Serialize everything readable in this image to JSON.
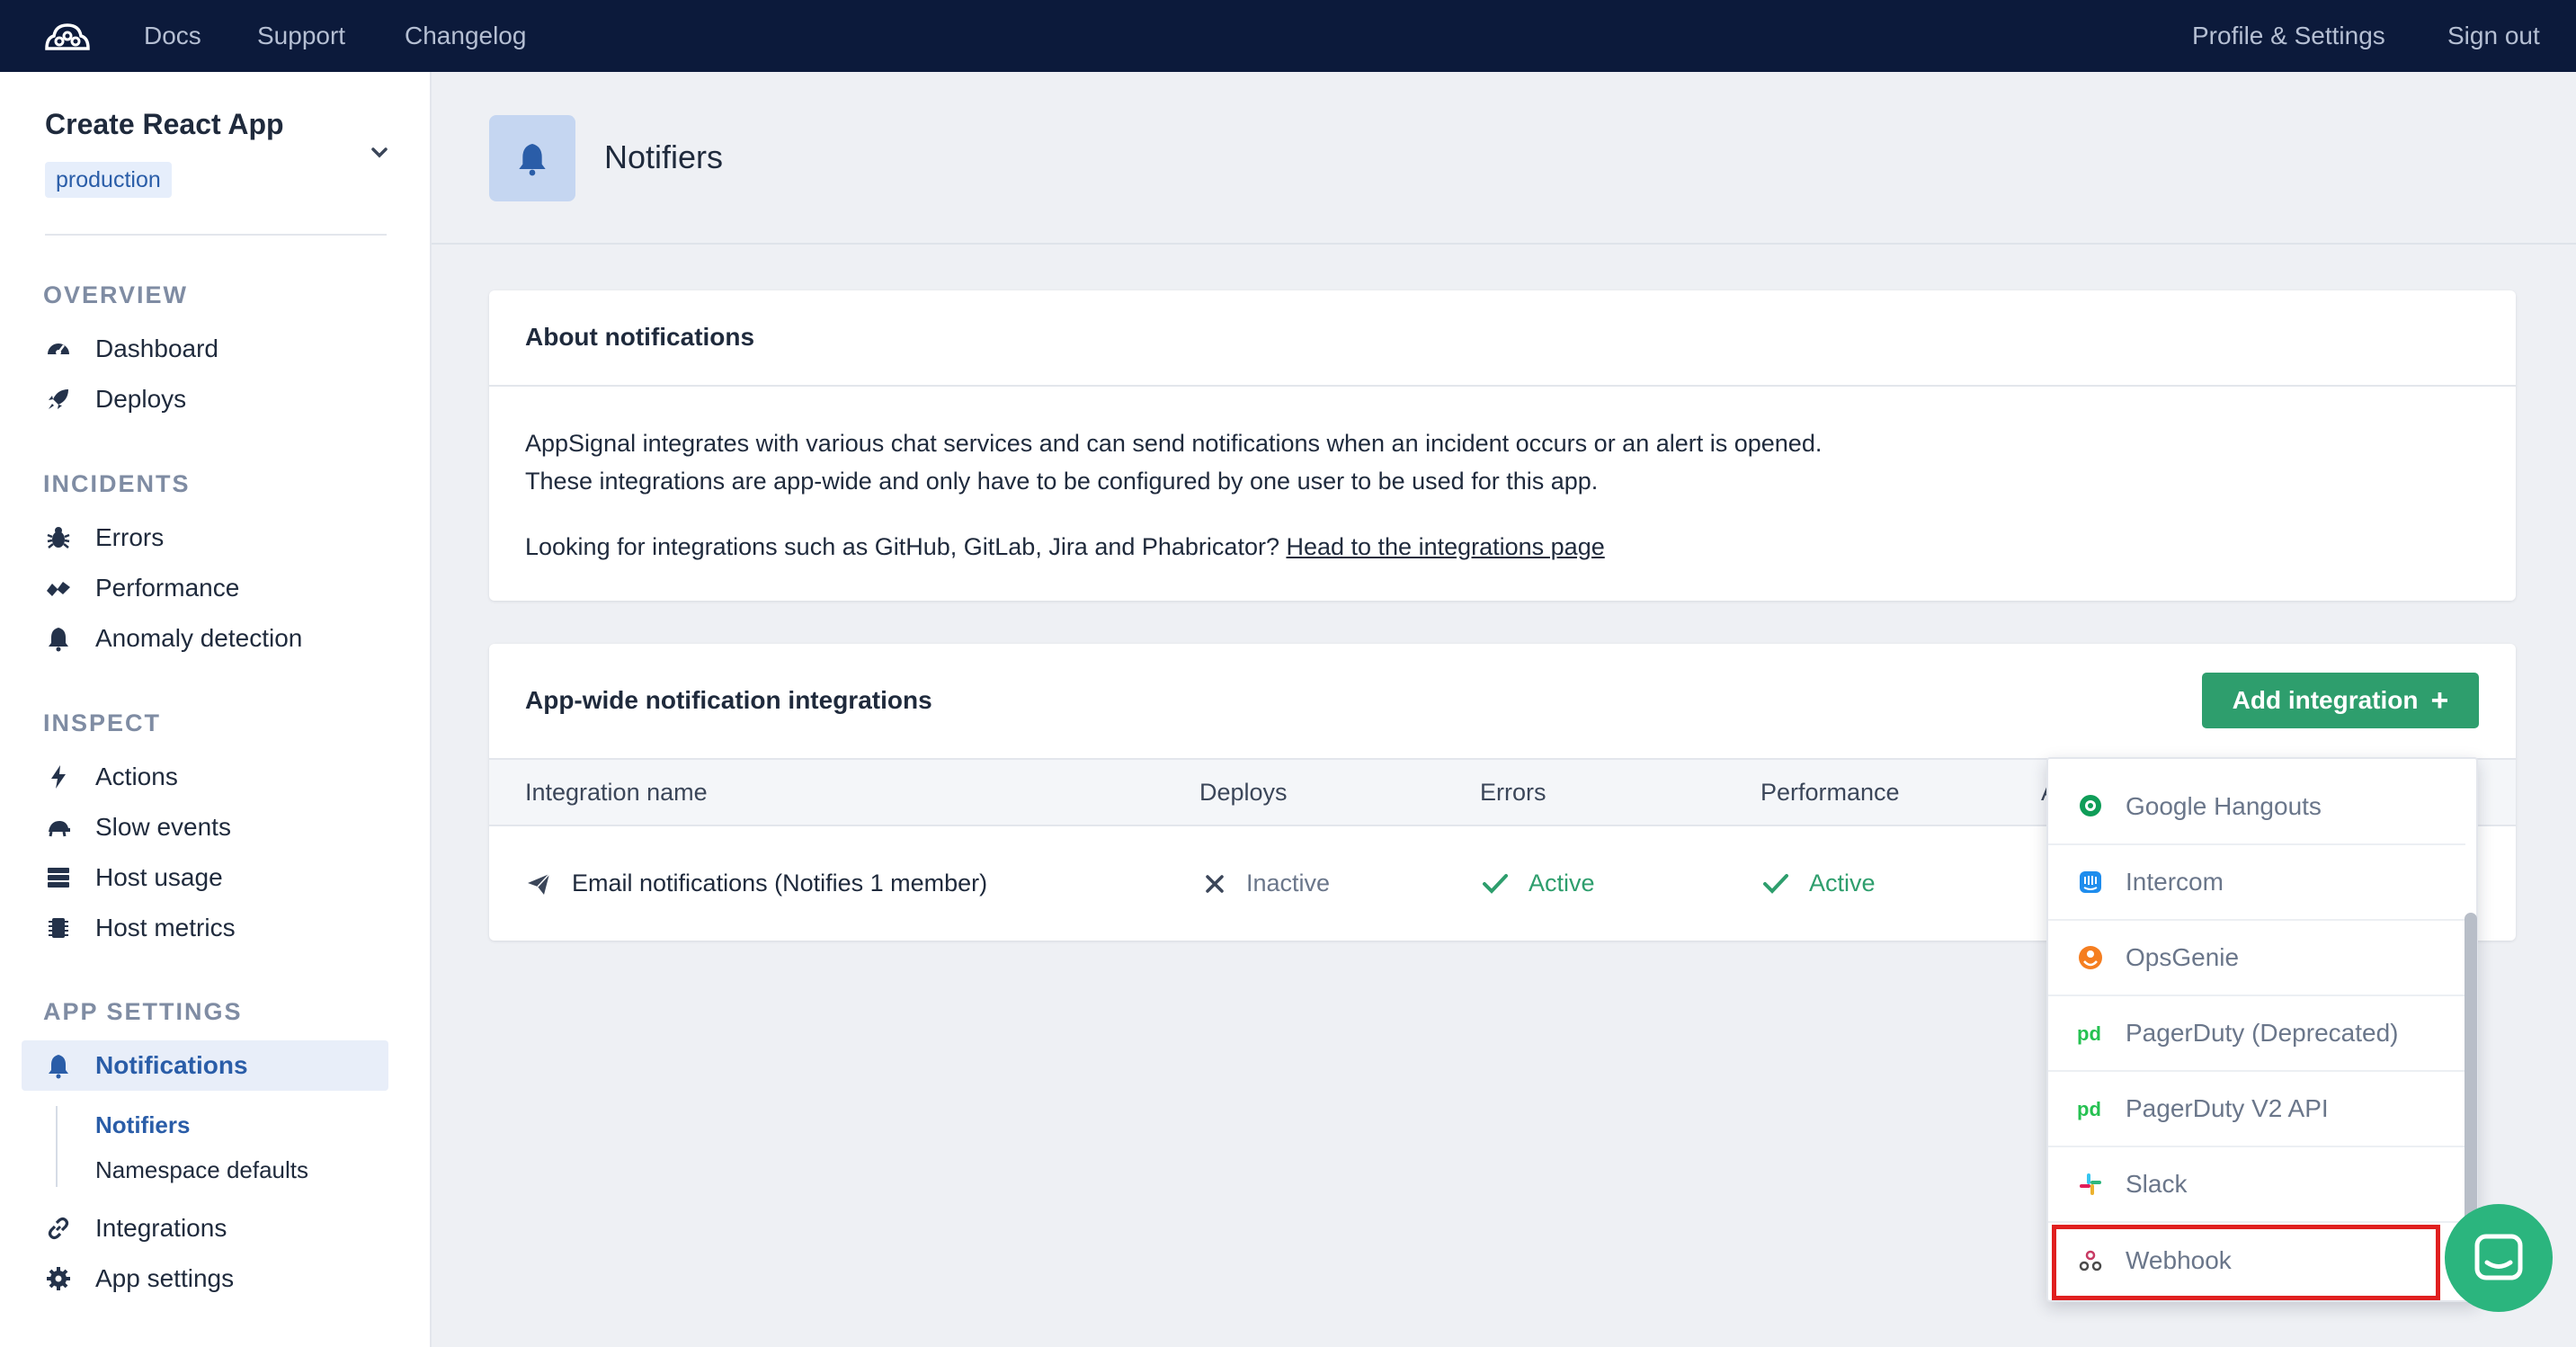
{
  "topbar": {
    "links": [
      "Docs",
      "Support",
      "Changelog"
    ],
    "right_links": [
      "Profile & Settings",
      "Sign out"
    ]
  },
  "sidebar": {
    "app_name": "Create React App",
    "environment": "production",
    "sections": {
      "overview": "OVERVIEW",
      "incidents": "INCIDENTS",
      "inspect": "INSPECT",
      "app_settings": "APP SETTINGS"
    },
    "items": {
      "dashboard": "Dashboard",
      "deploys": "Deploys",
      "errors": "Errors",
      "performance": "Performance",
      "anomaly": "Anomaly detection",
      "actions": "Actions",
      "slow_events": "Slow events",
      "host_usage": "Host usage",
      "host_metrics": "Host metrics",
      "notifications": "Notifications",
      "notifiers": "Notifiers",
      "namespace_defaults": "Namespace defaults",
      "integrations": "Integrations",
      "app_settings": "App settings"
    }
  },
  "header": {
    "title": "Notifiers"
  },
  "about": {
    "title": "About notifications",
    "line1": "AppSignal integrates with various chat services and can send notifications when an incident occurs or an alert is opened.",
    "line2": "These integrations are app-wide and only have to be configured by one user to be used for this app.",
    "line3_prefix": "Looking for integrations such as GitHub, GitLab, Jira and Phabricator? ",
    "line3_link": "Head to the integrations page"
  },
  "integrations": {
    "title": "App-wide notification integrations",
    "add_button": "Add integration",
    "columns": [
      "Integration name",
      "Deploys",
      "Errors",
      "Performance",
      "A"
    ],
    "row": {
      "name": "Email notifications (Notifies 1 member)",
      "deploys": "Inactive",
      "errors": "Active",
      "performance": "Active"
    }
  },
  "dropdown": {
    "items": [
      "Google Hangouts",
      "Intercom",
      "OpsGenie",
      "PagerDuty (Deprecated)",
      "PagerDuty V2 API",
      "Slack",
      "Webhook"
    ]
  },
  "colors": {
    "topbar": "#0c1a3b",
    "accent": "#2a5da8",
    "success": "#2e9e6d",
    "highlight": "#e01f1f"
  }
}
